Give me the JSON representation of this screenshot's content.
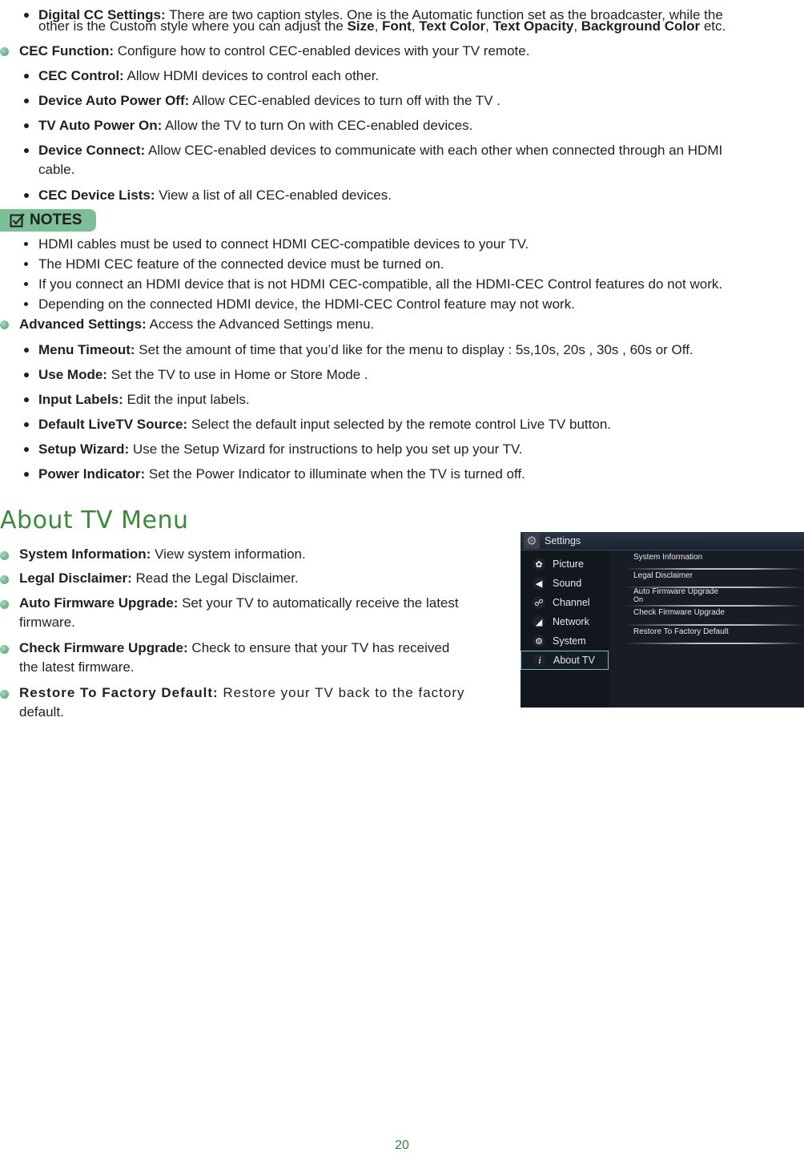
{
  "digital_cc": {
    "label": "Digital CC Settings:",
    "text1": " There are two caption styles. One is the Automatic function set as the broadcaster, while the",
    "text2": "other is the Custom style where you can adjust the ",
    "size": "Size",
    "font": "Font",
    "text_color": "Text Color",
    "text_opacity": "Text Opacity",
    "bg_color": "Background Color",
    "comma": ", ",
    "etc": " etc."
  },
  "cec": {
    "label": "CEC Function:",
    "text": " Configure how to control CEC-enabled devices with your TV remote.",
    "items": [
      {
        "label": "CEC Control:",
        "text": " Allow HDMI devices to control each other."
      },
      {
        "label": "Device Auto Power Off:",
        "text": " Allow CEC-enabled devices to turn off with the TV ."
      },
      {
        "label": "TV Auto Power On:",
        "text": " Allow the TV to turn On with CEC-enabled devices."
      },
      {
        "label": "Device Connect:",
        "text": " Allow CEC-enabled devices to communicate with each other when connected through an HDMI",
        "text2": "cable."
      },
      {
        "label": "CEC Device Lists:",
        "text": " View a list of all CEC-enabled devices."
      }
    ]
  },
  "notes": {
    "label": "NOTES",
    "items": [
      "HDMI cables must be used to connect HDMI CEC-compatible devices to your TV.",
      "The HDMI CEC feature of the connected device must be turned on.",
      "If you connect an HDMI device that is not HDMI CEC-compatible, all the HDMI-CEC Control features do not work.",
      "Depending on the connected HDMI device, the HDMI-CEC Control feature may not work."
    ]
  },
  "advanced": {
    "label": "Advanced Settings:",
    "text": " Access the Advanced Settings menu.",
    "items": [
      {
        "label": "Menu Timeout:",
        "text": " Set the amount of time that you’d like for the menu to display : 5s,10s, 20s , 30s , 60s or Off."
      },
      {
        "label": "Use Mode:",
        "text": " Set the TV to use in Home or Store Mode ."
      },
      {
        "label": "Input Labels:",
        "text": " Edit the input labels."
      },
      {
        "label": "Default LiveTV Source:",
        "text": " Select the default input selected by the remote control Live TV button."
      },
      {
        "label": "Setup Wizard:",
        "text": " Use the Setup Wizard for instructions to help you set up your TV."
      },
      {
        "label": "Power Indicator:",
        "text": " Set the Power Indicator to illuminate when the TV is turned off."
      }
    ]
  },
  "about": {
    "title": "About TV Menu",
    "items": [
      {
        "label": "System Information:",
        "text": " View system information."
      },
      {
        "label": "Legal Disclaimer:",
        "text": " Read the Legal Disclaimer."
      },
      {
        "label": "Auto Firmware Upgrade:",
        "text": " Set your TV to automatically receive the latest",
        "text2": "firmware."
      },
      {
        "label": "Check Firmware Upgrade:",
        "text": " Check to ensure that your TV has received",
        "text2": "the latest firmware."
      },
      {
        "label": "Restore To Factory Default:",
        "text": " Restore your TV back to the factory",
        "text2": "default."
      }
    ]
  },
  "tv_screen": {
    "header": "Settings",
    "menu": [
      {
        "label": "Picture",
        "icon": "picture-icon"
      },
      {
        "label": "Sound",
        "icon": "speaker-icon"
      },
      {
        "label": "Channel",
        "icon": "satellite-dish-icon"
      },
      {
        "label": "Network",
        "icon": "network-icon"
      },
      {
        "label": "System",
        "icon": "gear-icon"
      },
      {
        "label": "About TV",
        "icon": "info-icon",
        "active": true
      }
    ],
    "options": [
      {
        "label": "System Information"
      },
      {
        "label": "Legal Disclaimer"
      },
      {
        "label": "Auto Firmware Upgrade",
        "value": "On"
      },
      {
        "label": "Check Firmware Upgrade"
      },
      {
        "label": "Restore To Factory Default"
      }
    ]
  },
  "page_number": "20",
  "colors": {
    "accent_green": "#3a8a3c",
    "notes_badge": "#7dbf96",
    "bullet_green": "#6db48c"
  }
}
